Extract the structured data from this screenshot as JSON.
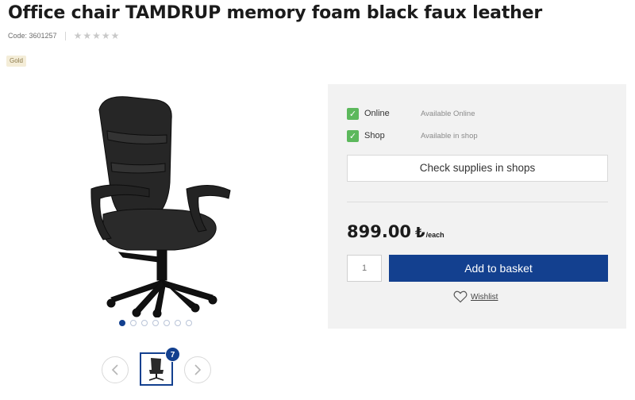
{
  "product": {
    "title": "Office chair TAMDRUP memory foam black faux leather",
    "code_label": "Code: 3601257",
    "rating_stars": 0,
    "rating_max": 5,
    "badge": "Gold"
  },
  "gallery": {
    "image_count": "7",
    "active_dot": 0,
    "dot_count": 7,
    "prev_icon": "chevron-left-icon",
    "next_icon": "chevron-right-icon"
  },
  "availability": [
    {
      "label": "Online",
      "status": "Available Online",
      "checked": true
    },
    {
      "label": "Shop",
      "status": "Available in shop",
      "checked": true
    }
  ],
  "buttons": {
    "check_supplies": "Check supplies in shops",
    "add_to_basket": "Add to basket",
    "wishlist": "Wishlist"
  },
  "price": {
    "value": "899.00",
    "currency": "₺",
    "unit": "/each"
  },
  "quantity": {
    "placeholder": "1"
  },
  "colors": {
    "brand_blue": "#13408f",
    "check_green": "#5cb85c",
    "panel_bg": "#f2f2f2"
  }
}
